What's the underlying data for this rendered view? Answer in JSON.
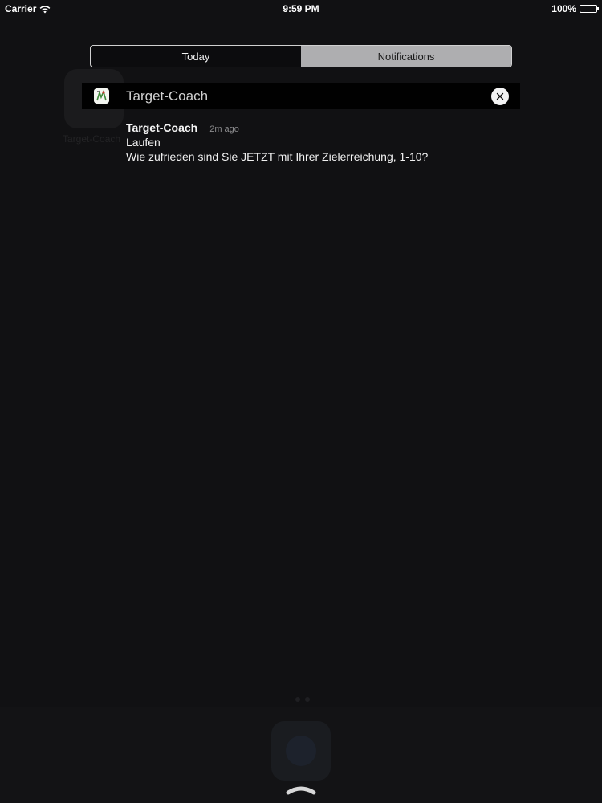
{
  "status_bar": {
    "carrier": "Carrier",
    "time": "9:59 PM",
    "battery": "100%",
    "battery_level": 1.0,
    "wifi_icon": "wifi-icon",
    "battery_icon": "battery-icon"
  },
  "segments": [
    {
      "label": "Today",
      "selected": false
    },
    {
      "label": "Notifications",
      "selected": true
    }
  ],
  "notification_group": {
    "app_name": "Target-Coach",
    "app_icon": "target-coach-app-icon",
    "close_icon": "close-icon"
  },
  "notification": {
    "app_name": "Target-Coach",
    "time": "2m ago",
    "title": "Laufen",
    "body": "Wie zufrieden sind Sie JETZT mit Ihrer Zielerreichung, 1-10?"
  },
  "background": {
    "ghost_app_label": "Target-Coach"
  },
  "colors": {
    "background": "#111113",
    "header_bar": "#010101",
    "segment_selected": "#aeaeb0"
  }
}
